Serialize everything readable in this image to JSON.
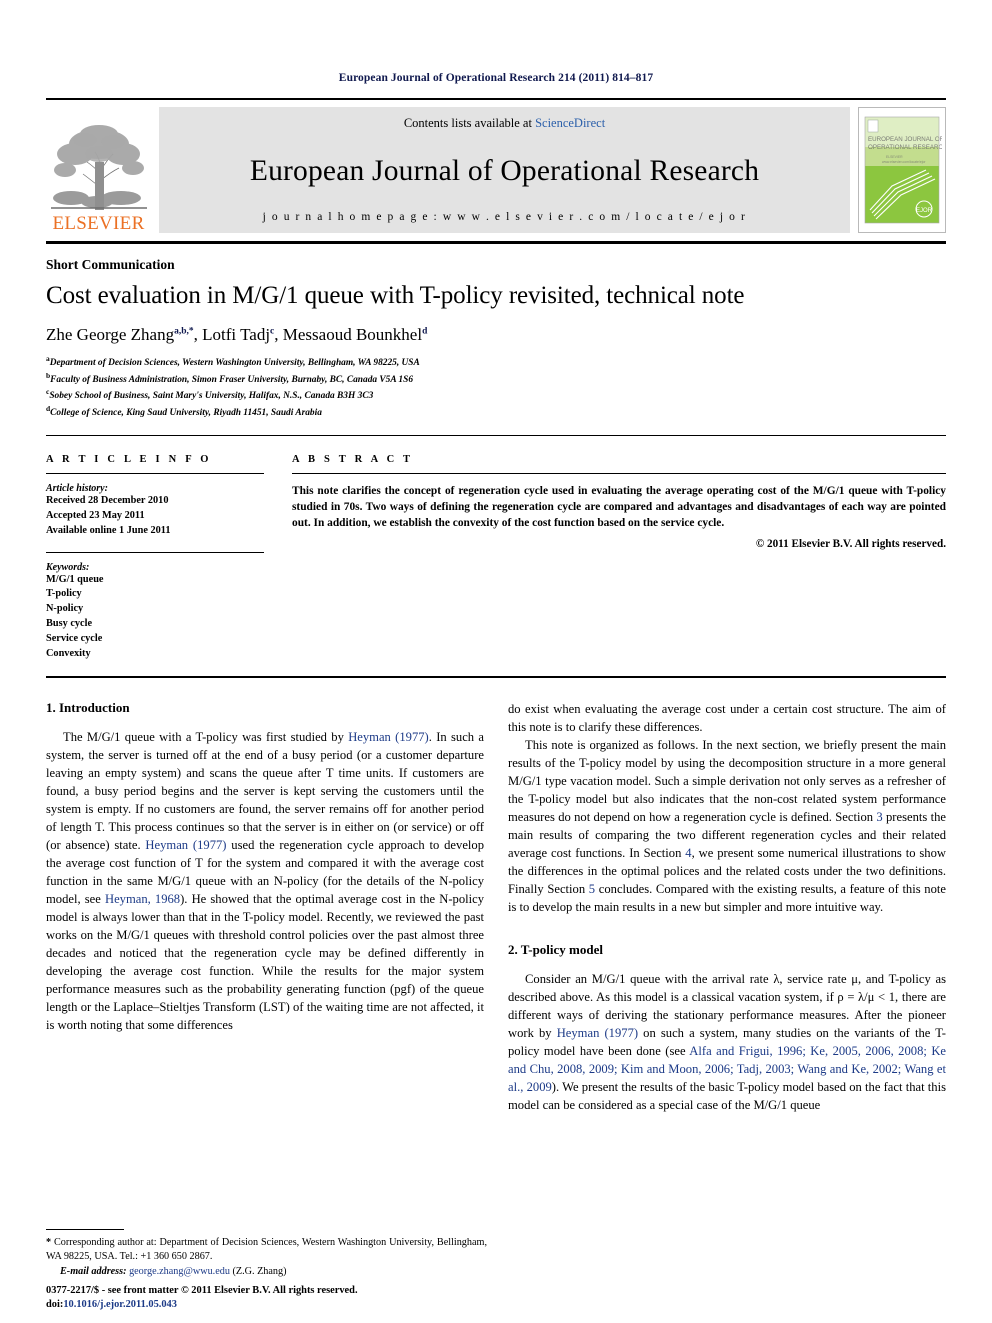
{
  "running_head": "European Journal of Operational Research 214 (2011) 814–817",
  "masthead": {
    "publisher_name": "ELSEVIER",
    "contents_prefix": "Contents lists available at ",
    "contents_link": "ScienceDirect",
    "journal_title": "European Journal of Operational Research",
    "homepage_line": "j o u r n a l   h o m e p a g e :   w w w . e l s e v i e r . c o m / l o c a t e / e j o r",
    "cover_title_line1": "EUROPEAN JOURNAL OF",
    "cover_title_line2": "OPERATIONAL RESEARCH"
  },
  "title_block": {
    "article_type": "Short Communication",
    "title": "Cost evaluation in M/G/1 queue with T-policy revisited, technical note",
    "authors": [
      {
        "name": "Zhe George Zhang",
        "sup": "a,b,*"
      },
      {
        "name": "Lotfi Tadj",
        "sup": "c"
      },
      {
        "name": "Messaoud Bounkhel",
        "sup": "d"
      }
    ],
    "affiliations": [
      {
        "label": "a",
        "text": "Department of Decision Sciences, Western Washington University, Bellingham, WA 98225, USA"
      },
      {
        "label": "b",
        "text": "Faculty of Business Administration, Simon Fraser University, Burnaby, BC, Canada V5A 1S6"
      },
      {
        "label": "c",
        "text": "Sobey School of Business, Saint Mary's University, Halifax, N.S., Canada B3H 3C3"
      },
      {
        "label": "d",
        "text": "College of Science, King Saud University, Riyadh 11451, Saudi Arabia"
      }
    ]
  },
  "article_info": {
    "heading": "A R T I C L E   I N F O",
    "history_label": "Article history:",
    "history": [
      "Received 28 December 2010",
      "Accepted 23 May 2011",
      "Available online 1 June 2011"
    ],
    "keywords_label": "Keywords:",
    "keywords": [
      "M/G/1 queue",
      "T-policy",
      "N-policy",
      "Busy cycle",
      "Service cycle",
      "Convexity"
    ]
  },
  "abstract": {
    "heading": "A B S T R A C T",
    "text": "This note clarifies the concept of regeneration cycle used in evaluating the average operating cost of the M/G/1 queue with T-policy studied in 70s. Two ways of defining the regeneration cycle are compared and advantages and disadvantages of each way are pointed out. In addition, we establish the convexity of the cost function based on the service cycle.",
    "copyright": "© 2011 Elsevier B.V. All rights reserved."
  },
  "body": {
    "left_column": {
      "section1_heading": "1. Introduction",
      "paragraph1_part1": "The M/G/1 queue with a T-policy was first studied by ",
      "paragraph1_ref1": "Heyman (1977)",
      "paragraph1_part2": ". In such a system, the server is turned off at the end of a busy period (or a customer departure leaving an empty system) and scans the queue after T time units. If customers are found, a busy period begins and the server is kept serving the customers until the system is empty. If no customers are found, the server remains off for another period of length T. This process continues so that the server is in either on (or service) or off (or absence) state. ",
      "paragraph1_ref2": "Heyman (1977)",
      "paragraph1_part3": " used the regeneration cycle approach to develop the average cost function of T for the system and compared it with the average cost function in the same M/G/1 queue with an N-policy (for the details of the N-policy model, see ",
      "paragraph1_ref3": "Heyman, 1968",
      "paragraph1_part4": "). He showed that the optimal average cost in the N-policy model is always lower than that in the T-policy model. Recently, we reviewed the past works on the M/G/1 queues with threshold control policies over the past almost three decades and noticed that the regeneration cycle may be defined differently in developing the average cost function. While the results for the major system performance measures such as the probability generating function (pgf) of the queue length or the Laplace–Stieltjes Transform (LST) of the waiting time are not affected, it is worth noting that some differences"
    },
    "right_column": {
      "paragraph1_cont": "do exist when evaluating the average cost under a certain cost structure. The aim of this note is to clarify these differences.",
      "paragraph2_part1": "This note is organized as follows. In the next section, we briefly present the main results of the T-policy model by using the decomposition structure in a more general M/G/1 type vacation model. Such a simple derivation not only serves as a refresher of the T-policy model but also indicates that the non-cost related system performance measures do not depend on how a regeneration cycle is defined. Section ",
      "paragraph2_ref1": "3",
      "paragraph2_part2": " presents the main results of comparing the two different regeneration cycles and their related average cost functions. In Section ",
      "paragraph2_ref2": "4",
      "paragraph2_part3": ", we present some numerical illustrations to show the differences in the optimal polices and the related costs under the two definitions. Finally Section ",
      "paragraph2_ref3": "5",
      "paragraph2_part4": " concludes. Compared with the existing results, a feature of this note is to develop the main results in a new but simpler and more intuitive way.",
      "section2_heading": "2. T-policy model",
      "paragraph3_part1": "Consider an M/G/1 queue with the arrival rate λ, service rate μ, and T-policy as described above. As this model is a classical vacation system, if ρ = λ/μ < 1, there are different ways of deriving the stationary performance measures. After the pioneer work by ",
      "paragraph3_ref1": "Heyman (1977)",
      "paragraph3_part2": " on such a system, many studies on the variants of the T-policy model have been done (see ",
      "paragraph3_ref2": "Alfa and Frigui, 1996; Ke, 2005, 2006, 2008; Ke and Chu, 2008, 2009; Kim and Moon, 2006; Tadj, 2003; Wang and Ke, 2002; Wang et al., 2009",
      "paragraph3_part3": "). We present the results of the basic T-policy model based on the fact that this model can be considered as a special case of the M/G/1 queue"
    }
  },
  "footnote": {
    "star": "*",
    "text": " Corresponding author at: Department of Decision Sciences, Western Washington University, Bellingham, WA 98225, USA. Tel.: +1 360 650 2867.",
    "email_label": "E-mail address:",
    "email": "george.zhang@wwu.edu",
    "email_suffix": " (Z.G. Zhang)"
  },
  "imprint": {
    "line1": "0377-2217/$ - see front matter © 2011 Elsevier B.V. All rights reserved.",
    "doi_label": "doi:",
    "doi_value": "10.1016/j.ejor.2011.05.043"
  },
  "colors": {
    "link_blue": "#1c3a87",
    "sciencedirect_blue": "#2b5faa",
    "elsevier_orange": "#eb7125",
    "cover_green": "#8cc63f",
    "band_grey": "#e3e3e3"
  }
}
